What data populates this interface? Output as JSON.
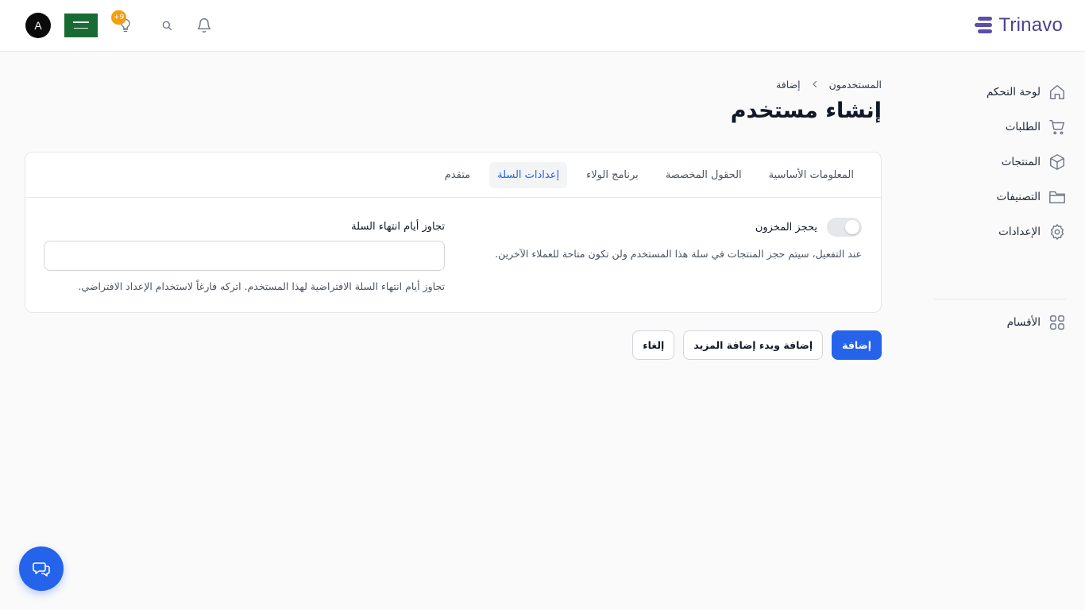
{
  "brand": {
    "name": "Trinavo",
    "color": "#4b4290"
  },
  "topbar": {
    "avatar_initial": "A",
    "notification_badge": "+9",
    "icons": [
      "lightbulb-icon",
      "search-icon",
      "bell-icon"
    ]
  },
  "sidebar": {
    "items": [
      {
        "label": "لوحة التحكم",
        "icon": "home-icon"
      },
      {
        "label": "الطلبات",
        "icon": "cart-icon"
      },
      {
        "label": "المنتجات",
        "icon": "box-icon"
      },
      {
        "label": "التصنيفات",
        "icon": "folder-icon"
      },
      {
        "label": "الإعدادات",
        "icon": "gear-icon"
      }
    ],
    "sections": {
      "label": "الأقسام",
      "icon": "grid-icon"
    }
  },
  "breadcrumb": {
    "parent": "المستخدمون",
    "current": "إضافة"
  },
  "page": {
    "title": "إنشاء مستخدم"
  },
  "tabs": [
    {
      "label": "المعلومات الأساسية",
      "active": false
    },
    {
      "label": "الحقول المخصصة",
      "active": false
    },
    {
      "label": "برنامج الولاء",
      "active": false
    },
    {
      "label": "إعدادات السلة",
      "active": true
    },
    {
      "label": "متقدم",
      "active": false
    }
  ],
  "form": {
    "reserve_stock": {
      "label": "يحجز المخزون",
      "enabled": false,
      "help": "عند التفعيل، سيتم حجز المنتجات في سلة هذا المستخدم ولن تكون متاحة للعملاء الآخرين."
    },
    "cart_expiry": {
      "label": "تجاوز أيام انتهاء السلة",
      "value": "",
      "help": "تجاوز أيام انتهاء السلة الافتراضية لهذا المستخدم. اتركه فارغاً لاستخدام الإعداد الافتراضي."
    }
  },
  "actions": {
    "add": "إضافة",
    "add_and_more": "إضافة وبدء إضافة المزيد",
    "cancel": "إلغاء"
  },
  "colors": {
    "primary": "#2563eb",
    "badge": "#f59e0b",
    "flag": "#1a6b33"
  }
}
